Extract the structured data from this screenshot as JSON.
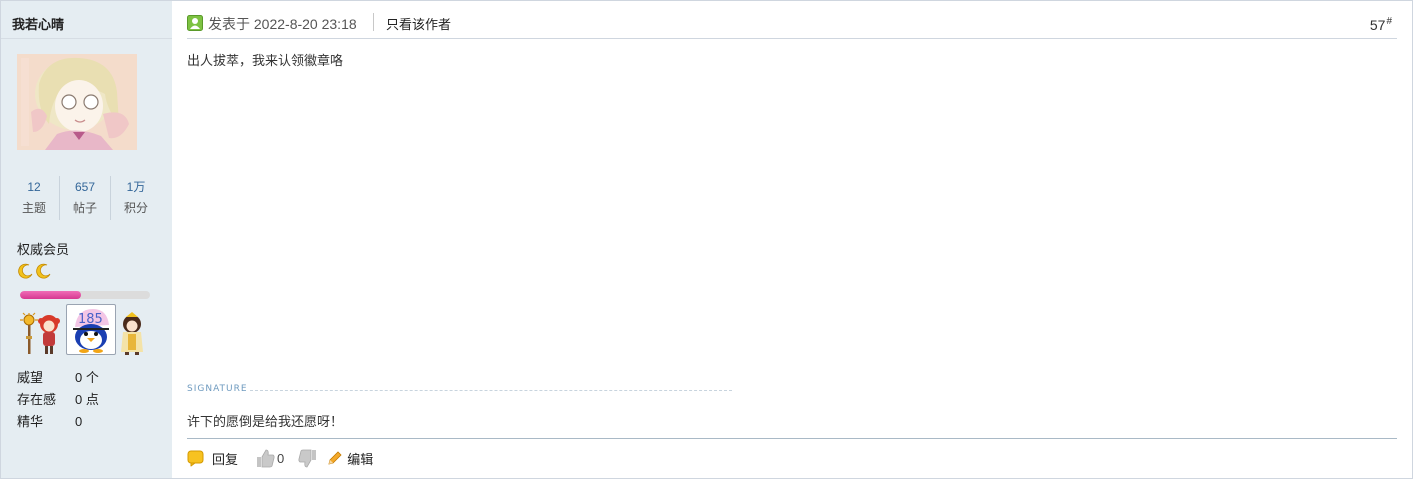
{
  "user": {
    "name": "我若心晴",
    "stats": [
      {
        "value": "12",
        "label": "主题"
      },
      {
        "value": "657",
        "label": "帖子"
      },
      {
        "value": "1万",
        "label": "积分"
      }
    ],
    "group": "权威会员",
    "level_progress": 0.47,
    "fields": [
      {
        "label": "威望",
        "value": "0 个"
      },
      {
        "label": "存在感",
        "value": "0 点"
      },
      {
        "label": "精华",
        "value": "0"
      }
    ]
  },
  "post": {
    "time": "发表于 2022-8-20 23:18",
    "only_author": "只看该作者",
    "floor": "57",
    "floor_suffix": "#",
    "content": "出人拔萃，我来认领徽章咯",
    "signature_label": "SIGNATURE",
    "signature": "许下的愿倒是给我还愿呀！"
  },
  "actions": {
    "reply": "回复",
    "like_count": "0",
    "edit": "编辑"
  },
  "icons": {
    "online": "online-status-icon",
    "reply": "reply-bubble-icon",
    "like": "thumb-up-icon",
    "dislike": "thumb-down-icon",
    "edit": "pencil-icon",
    "moon": "moon-icon"
  },
  "colors": {
    "sidebar_bg": "#e5edf2",
    "progress_fill": "#e14ea3",
    "stat_number": "#336699"
  }
}
